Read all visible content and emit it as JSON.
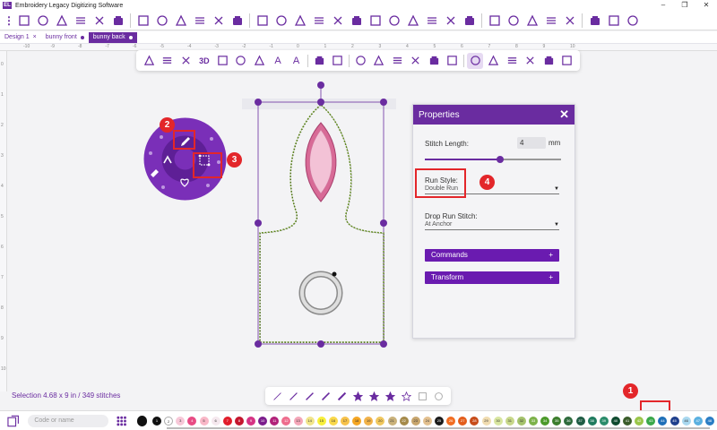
{
  "app": {
    "title": "Embroidery Legacy Digitizing Software",
    "logo_text": "EL"
  },
  "window_controls": [
    "–",
    "❐",
    "✕"
  ],
  "main_toolbar": {
    "menu_icon": "⋮",
    "icons": [
      "document-icon",
      "open-folder-icon",
      "save-icon",
      "save-as-icon",
      "print-icon",
      "export-icon",
      "hoop-icon",
      "redo-icon",
      "cut-icon",
      "copy-icon",
      "paste-icon",
      "delete-icon",
      "select-box-icon",
      "crop-icon",
      "arch-icon",
      "grid-icon",
      "align-icon",
      "mirror-icon",
      "phone-icon",
      "split-icon",
      "frame-icon",
      "grid4-icon",
      "needle-icon",
      "measure-icon",
      "machine-icon",
      "color-wheel-icon",
      "stitch-icon",
      "export2-icon",
      "lock-icon",
      "list-icon",
      "layers-icon",
      "globe-icon"
    ]
  },
  "tabs": [
    {
      "label": "Design 1",
      "suffix": "×",
      "active": false
    },
    {
      "label": "bunny front",
      "suffix": "●",
      "active": false
    },
    {
      "label": "bunny back",
      "suffix": "●",
      "active": true
    }
  ],
  "ruler_top": [
    "-10",
    "-9",
    "-8",
    "-7",
    "-6",
    "-5",
    "-4",
    "-3",
    "-2",
    "-1",
    "0",
    "1",
    "2",
    "3",
    "4",
    "5",
    "6",
    "7",
    "8",
    "9",
    "10"
  ],
  "ruler_left": [
    "0",
    "1",
    "2",
    "3",
    "4",
    "5",
    "6",
    "7",
    "8",
    "9",
    "10"
  ],
  "secondary_toolbar": {
    "icons": [
      "pointer-icon",
      "node-select-icon",
      "box-select-icon",
      "3d-icon",
      "monitor-icon",
      "hand-icon",
      "zoom-icon",
      "text-icon",
      "text-outline-icon",
      "folder-icon",
      "image-icon",
      "pen-icon",
      "bezier-icon",
      "shape-edit-icon",
      "point-icon",
      "arrow-icon",
      "run-icon",
      "fill-icon",
      "applique-icon",
      "cross-icon",
      "sparkle-icon",
      "picture-icon",
      "photo-stitch-icon"
    ],
    "labels": {
      "3d": "3D"
    }
  },
  "radial_menu": {
    "items": [
      "pencil-icon",
      "eraser-icon",
      "node-edit-icon",
      "heart-icon",
      "arrow-up-icon"
    ]
  },
  "properties": {
    "title": "Properties",
    "close": "✕",
    "stitch_length_label": "Stitch Length:",
    "stitch_length_value": "4",
    "stitch_length_unit": "mm",
    "stitch_length_slider_fraction": 0.55,
    "run_style_label": "Run Style:",
    "run_style_value": "Double Run",
    "drop_run_label": "Drop Run Stitch:",
    "drop_run_value": "At Anchor",
    "commands_label": "Commands",
    "transform_label": "Transform",
    "plus": "+"
  },
  "callouts": [
    {
      "number": "1"
    },
    {
      "number": "2"
    },
    {
      "number": "3"
    },
    {
      "number": "4"
    }
  ],
  "status": {
    "text": "Selection   4.68 x 9 in / 349 stitches"
  },
  "bottom_tools": {
    "icons": [
      "line-icon",
      "curve-icon",
      "brush-icon",
      "calligraphy-icon",
      "satin-icon",
      "star-icon",
      "star2-icon",
      "star3-icon",
      "star-outline-icon",
      "square-icon",
      "circle-icon"
    ]
  },
  "palette": {
    "search_placeholder": "Code or name",
    "colors": [
      {
        "code": "1",
        "hex": "#111111",
        "text": "#ffffff"
      },
      {
        "code": "2",
        "hex": "#ffffff",
        "text": "#333333"
      },
      {
        "code": "3",
        "hex": "#f7c8d8",
        "text": "#333333"
      },
      {
        "code": "4",
        "hex": "#e84b84",
        "text": "#ffffff"
      },
      {
        "code": "5",
        "hex": "#f9b7c7",
        "text": "#333333"
      },
      {
        "code": "6",
        "hex": "#f5e8ee",
        "text": "#333333"
      },
      {
        "code": "7",
        "hex": "#e11d2b",
        "text": "#ffffff"
      },
      {
        "code": "8",
        "hex": "#c4162e",
        "text": "#ffffff"
      },
      {
        "code": "9",
        "hex": "#d63384",
        "text": "#ffffff"
      },
      {
        "code": "10",
        "hex": "#7b1c8c",
        "text": "#ffffff"
      },
      {
        "code": "11",
        "hex": "#b1227a",
        "text": "#ffffff"
      },
      {
        "code": "12",
        "hex": "#ee6d8d",
        "text": "#ffffff"
      },
      {
        "code": "13",
        "hex": "#f4a6b8",
        "text": "#333333"
      },
      {
        "code": "14",
        "hex": "#f1e58a",
        "text": "#333333"
      },
      {
        "code": "15",
        "hex": "#f7ef3a",
        "text": "#333333"
      },
      {
        "code": "16",
        "hex": "#f9d84a",
        "text": "#333333"
      },
      {
        "code": "17",
        "hex": "#f7c24a",
        "text": "#333333"
      },
      {
        "code": "18",
        "hex": "#f5a623",
        "text": "#333333"
      },
      {
        "code": "19",
        "hex": "#f1b24a",
        "text": "#333333"
      },
      {
        "code": "20",
        "hex": "#f0c75e",
        "text": "#333333"
      },
      {
        "code": "21",
        "hex": "#c9b17a",
        "text": "#333333"
      },
      {
        "code": "22",
        "hex": "#a58a4a",
        "text": "#ffffff"
      },
      {
        "code": "23",
        "hex": "#c7a56d",
        "text": "#333333"
      },
      {
        "code": "24",
        "hex": "#e3c08f",
        "text": "#333333"
      },
      {
        "code": "25",
        "hex": "#1a1a1a",
        "text": "#ffffff"
      },
      {
        "code": "26",
        "hex": "#f26d21",
        "text": "#ffffff"
      },
      {
        "code": "27",
        "hex": "#e35d1b",
        "text": "#ffffff"
      },
      {
        "code": "28",
        "hex": "#c74c1a",
        "text": "#ffffff"
      },
      {
        "code": "29",
        "hex": "#f0dcb0",
        "text": "#333333"
      },
      {
        "code": "30",
        "hex": "#d8e6a0",
        "text": "#333333"
      },
      {
        "code": "31",
        "hex": "#c8d88a",
        "text": "#333333"
      },
      {
        "code": "32",
        "hex": "#a4c26b",
        "text": "#333333"
      },
      {
        "code": "33",
        "hex": "#7db24a",
        "text": "#ffffff"
      },
      {
        "code": "34",
        "hex": "#4c9a2a",
        "text": "#ffffff"
      },
      {
        "code": "35",
        "hex": "#3b7d2c",
        "text": "#ffffff"
      },
      {
        "code": "36",
        "hex": "#2e6b3c",
        "text": "#ffffff"
      },
      {
        "code": "37",
        "hex": "#1f5c44",
        "text": "#ffffff"
      },
      {
        "code": "38",
        "hex": "#1e7b5e",
        "text": "#ffffff"
      },
      {
        "code": "39",
        "hex": "#2a8c6a",
        "text": "#ffffff"
      },
      {
        "code": "40",
        "hex": "#0f4a2f",
        "text": "#ffffff"
      },
      {
        "code": "41",
        "hex": "#3a5c2a",
        "text": "#ffffff"
      },
      {
        "code": "42",
        "hex": "#9ac64a",
        "text": "#ffffff"
      },
      {
        "code": "43",
        "hex": "#3aa84a",
        "text": "#ffffff"
      },
      {
        "code": "44",
        "hex": "#1d6fb8",
        "text": "#ffffff"
      },
      {
        "code": "45",
        "hex": "#1f3f8c",
        "text": "#ffffff"
      },
      {
        "code": "46",
        "hex": "#a9d8ef",
        "text": "#333333"
      },
      {
        "code": "47",
        "hex": "#5ab0e0",
        "text": "#ffffff"
      },
      {
        "code": "48",
        "hex": "#2b7dc4",
        "text": "#ffffff"
      }
    ]
  },
  "accent": "#6a2ca0",
  "callout_color": "#e3262a"
}
